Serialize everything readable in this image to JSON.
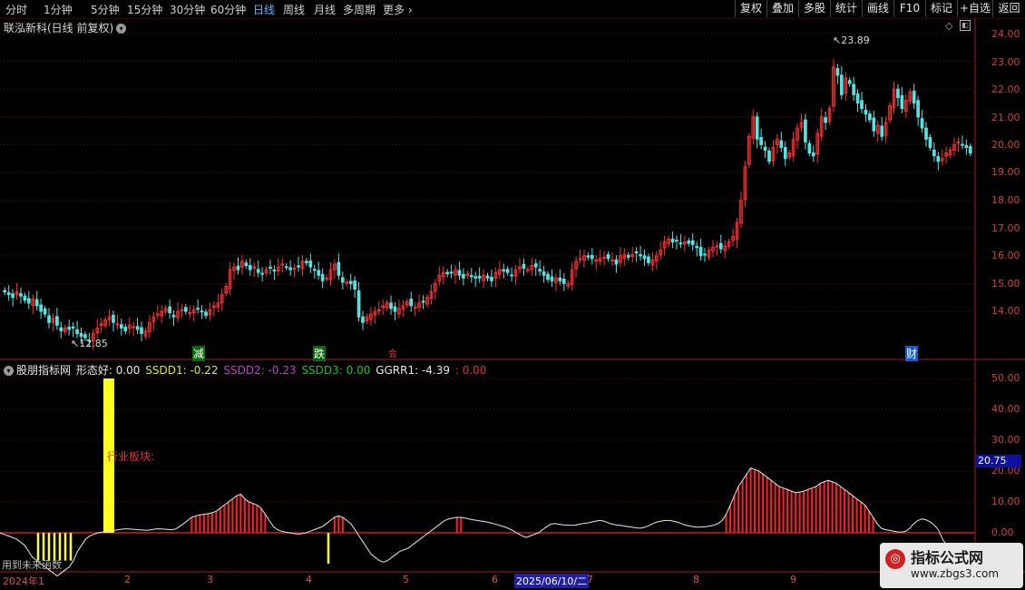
{
  "toolbar": {
    "periods": [
      "分时",
      "1分钟",
      "5分钟",
      "15分钟",
      "30分钟",
      "60分钟",
      "日线",
      "周线",
      "月线",
      "多周期",
      "更多"
    ],
    "active_period": "日线",
    "right_buttons": [
      "复权",
      "叠加",
      "多股",
      "统计",
      "画线",
      "F10",
      "标记",
      "+自选",
      "返回"
    ]
  },
  "chart_title": "联泓新科(日线 前复权)",
  "price_axis": [
    "24.00",
    "23.00",
    "22.00",
    "21.00",
    "20.00",
    "19.00",
    "18.00",
    "17.00",
    "16.00",
    "15.00",
    "14.00"
  ],
  "annotations": {
    "high": "23.89",
    "low": "12.85"
  },
  "event_tags": [
    {
      "text": "减",
      "color": "#22c022"
    },
    {
      "text": "跌",
      "color": "#22c022"
    },
    {
      "text": "会",
      "color": "#e03030"
    },
    {
      "text": "财",
      "color": "#2a8cff"
    }
  ],
  "indicator": {
    "name": "股朋指标网",
    "items": [
      {
        "label": "形态好: 0.00",
        "color": "#e8e8e8"
      },
      {
        "label": "SSDD1: -0.22",
        "color": "#e8e800"
      },
      {
        "label": "SSDD2: -0.23",
        "color": "#c040c0"
      },
      {
        "label": "SSDD3: 0.00",
        "color": "#22c022"
      },
      {
        "label": "GGRR1: -4.39",
        "color": "#e8e8e8"
      },
      {
        "label": ": 0.00",
        "color": "#e03030"
      }
    ],
    "axis": [
      "50.00",
      "40.00",
      "30.00",
      "20.00",
      "10.00",
      "0.00"
    ],
    "current_value": "20.75",
    "sector_label": "行业板块:",
    "bottom_note": "用到未来函数"
  },
  "x_axis": [
    "2024年1",
    "2",
    "3",
    "4",
    "5",
    "6",
    "2025/06/10/二",
    "7",
    "8",
    "9"
  ],
  "watermark": {
    "title": "指标公式网",
    "url": "www.zbgs3.com"
  },
  "chart_data": {
    "type": "candlestick",
    "ylim": [
      12.5,
      24.5
    ],
    "closes": [
      14.7,
      14.6,
      14.5,
      14.7,
      14.55,
      14.4,
      14.3,
      14.45,
      14.2,
      14.0,
      13.9,
      13.6,
      13.75,
      13.5,
      13.3,
      13.4,
      13.35,
      13.4,
      13.2,
      13.1,
      13.05,
      12.95,
      13.2,
      13.4,
      13.55,
      13.7,
      13.8,
      13.6,
      13.55,
      13.4,
      13.3,
      13.5,
      13.45,
      13.35,
      13.2,
      13.3,
      13.6,
      13.8,
      13.9,
      14.0,
      14.1,
      13.95,
      13.8,
      14.0,
      14.05,
      14.0,
      13.95,
      14.05,
      14.1,
      14.0,
      13.85,
      14.05,
      14.2,
      14.3,
      14.6,
      14.9,
      15.5,
      15.6,
      15.5,
      15.8,
      15.65,
      15.5,
      15.6,
      15.4,
      15.35,
      15.5,
      15.55,
      15.45,
      15.6,
      15.7,
      15.6,
      15.5,
      15.55,
      15.6,
      15.8,
      15.75,
      15.6,
      15.5,
      15.3,
      15.1,
      15.2,
      15.5,
      15.7,
      15.3,
      15.05,
      15.05,
      15.0,
      14.8,
      13.8,
      13.6,
      13.8,
      13.9,
      14.0,
      14.05,
      14.2,
      14.3,
      14.1,
      14.0,
      14.1,
      14.2,
      14.35,
      14.2,
      14.15,
      14.3,
      14.35,
      14.5,
      14.7,
      15.0,
      15.3,
      15.4,
      15.35,
      15.4,
      15.5,
      15.3,
      15.2,
      15.35,
      15.25,
      15.2,
      15.2,
      15.3,
      15.2,
      15.1,
      15.4,
      15.5,
      15.45,
      15.4,
      15.3,
      15.5,
      15.6,
      15.55,
      15.5,
      15.65,
      15.6,
      15.45,
      15.3,
      15.15,
      15.1,
      15.2,
      15.1,
      15.0,
      15.0,
      15.5,
      15.8,
      15.9,
      16.0,
      15.95,
      15.9,
      15.85,
      15.9,
      15.95,
      15.9,
      15.85,
      15.7,
      16.0,
      16.05,
      15.95,
      16.05,
      16.1,
      16.0,
      15.9,
      15.75,
      15.85,
      16.0,
      16.2,
      16.5,
      16.6,
      16.5,
      16.55,
      16.45,
      16.5,
      16.45,
      16.4,
      16.3,
      16.0,
      16.05,
      16.2,
      16.3,
      16.35,
      16.25,
      16.35,
      16.5,
      16.7,
      17.2,
      18.0,
      19.2,
      20.3,
      21.0,
      20.2,
      20.0,
      19.8,
      19.4,
      19.9,
      20.2,
      19.9,
      19.5,
      19.7,
      20.2,
      20.6,
      20.8,
      20.1,
      19.7,
      19.6,
      20.4,
      21.0,
      20.8,
      21.3,
      22.8,
      22.5,
      21.8,
      22.4,
      22.2,
      21.8,
      21.5,
      21.3,
      21.1,
      20.9,
      20.5,
      20.7,
      20.3,
      20.8,
      21.4,
      22.0,
      21.7,
      21.3,
      21.6,
      21.9,
      21.5,
      21.0,
      20.6,
      20.2,
      19.9,
      19.6,
      19.4,
      19.5,
      19.7,
      19.8,
      20.0,
      20.1,
      20.0,
      19.9,
      19.7
    ],
    "indicator_line": [
      0,
      -0.5,
      -1,
      -1.5,
      -2,
      -3,
      -4,
      -6,
      -8,
      -9,
      -10,
      -11,
      -12,
      -13,
      -14,
      -13,
      -12,
      -11,
      -9,
      -6,
      -4,
      -2,
      -1,
      -0.5,
      0,
      0.2,
      0.4,
      0.6,
      0.8,
      1,
      1.2,
      1.3,
      1.2,
      1.1,
      1,
      0.9,
      0.8,
      1,
      1.2,
      1.3,
      1.2,
      1.1,
      1,
      1.2,
      2,
      3,
      4,
      5,
      5.5,
      5.8,
      6,
      6.2,
      6.5,
      7,
      8,
      9,
      10,
      11,
      12,
      12.5,
      11,
      10,
      9.5,
      9,
      8,
      6,
      4,
      2,
      1,
      0.5,
      0.2,
      0,
      -0.2,
      -0.4,
      -0.3,
      0,
      0.5,
      1,
      1.5,
      2,
      3,
      4,
      5,
      5.5,
      5,
      4,
      3,
      1,
      -1,
      -3,
      -5,
      -7,
      -8,
      -9,
      -9.5,
      -9,
      -8,
      -7,
      -6,
      -5.5,
      -5,
      -4,
      -3,
      -2,
      -1,
      0,
      1,
      2,
      3,
      4,
      4.5,
      4.8,
      5,
      5,
      4.8,
      4.5,
      4.2,
      4,
      3.8,
      3.6,
      3.3,
      3,
      2.6,
      2.2,
      1.8,
      1.2,
      0.5,
      -0.3,
      -1,
      -1.5,
      -1,
      -0.5,
      0,
      1,
      2,
      2.8,
      3,
      2.8,
      2.6,
      2.5,
      2.4,
      2.5,
      2.8,
      3,
      3.2,
      3.5,
      3.8,
      4,
      3.8,
      3.3,
      2.8,
      2.6,
      2.4,
      2.2,
      2,
      1.8,
      1.6,
      1.5,
      1.8,
      2.3,
      3,
      3.5,
      3.8,
      4,
      4,
      3.8,
      3.5,
      3,
      2.5,
      2.2,
      2.0,
      1.8,
      1.9,
      2.0,
      2.2,
      2.5,
      3,
      4,
      6,
      9,
      12,
      15,
      17,
      19,
      21,
      20.5,
      20,
      19,
      18,
      17,
      16,
      15,
      14.5,
      14,
      13.5,
      13,
      13.2,
      13.5,
      14,
      14.5,
      15,
      16,
      16.5,
      17,
      16.5,
      16,
      15,
      14,
      13,
      12,
      11,
      10,
      9,
      7,
      5,
      3,
      1.5,
      1,
      0.8,
      0.5,
      0.3,
      0.2,
      0.5,
      1.5,
      3,
      4,
      4.5,
      4.2,
      3.5,
      2.5,
      1,
      -2,
      -4,
      -5,
      -5.5,
      -5,
      -4.5,
      -4,
      -3.5
    ]
  }
}
